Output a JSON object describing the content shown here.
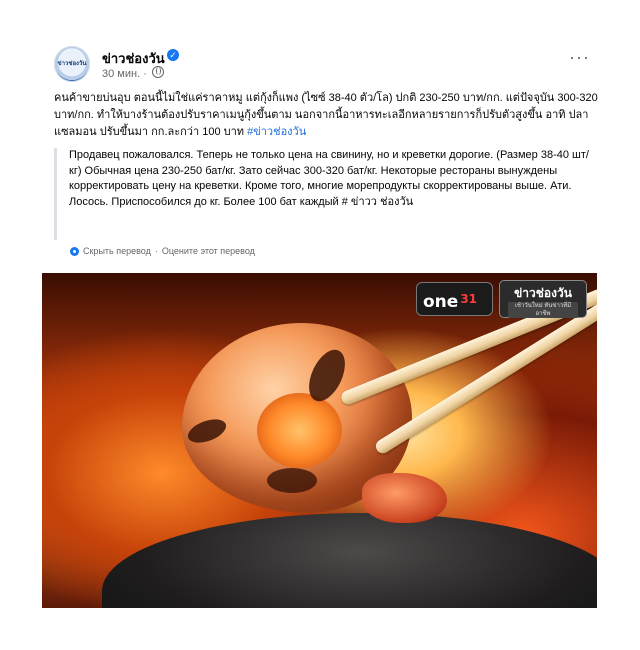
{
  "post": {
    "page_name": "ข่าวช่องวัน",
    "avatar_text": "ข่าวช่องวัน",
    "time": "30 мин.",
    "verified_icon": "verified-badge-icon",
    "privacy_icon": "globe-icon",
    "more_label": "···",
    "text_main": "คนค้าขายบ่นอุบ ตอนนี้ไม่ใช่แค่ราคาหมู แต่กุ้งก็แพง (ไซซ์ 38-40 ตัว/โล) ปกติ 230-250 บาท/กก. แต่ปัจจุบัน 300-320 บาท/กก. ทำให้บางร้านต้องปรับราคาเมนูกุ้งขึ้นตาม นอกจากนี้อาหารทะเลอีกหลายรายการก็ปรับตัวสูงขึ้น อาทิ ปลาแซลมอน ปรับขึ้นมา กก.ละกว่า 100 บาท ",
    "hashtag": "#ข่าวช่องวัน",
    "translation": "Продавец пожаловался. Теперь не только цена на свинину, но и креветки дорогие. (Размер 38-40 шт/кг) Обычная цена 230-250 бат/кг. Зато сейчас 300-320 бат/кг. Некоторые рестораны вынуждены корректировать цену на креветки. Кроме того, многие морепродукты скорректированы выше. Ати. Лосось. Приспособился до кг. Более 100 бат каждый # ข่าวว ช่องวัน",
    "hide_translation": "Скрыть перевод",
    "separator": "·",
    "rate_translation": "Оцените этот перевод"
  },
  "photo": {
    "logo_channel": "one",
    "logo_channel_num": "31",
    "logo_news_title": "ข่าวช่องวัน",
    "logo_news_sub": "เช้าวันใหม่ ทันข่าวที่มีอาชีพ",
    "colors": {
      "fire": "#e8641e",
      "shrimp": "#f59a5a"
    }
  }
}
